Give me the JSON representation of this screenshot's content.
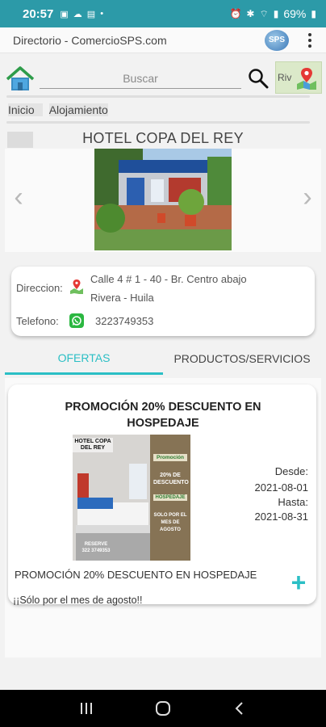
{
  "status_bar": {
    "time": "20:57",
    "battery": "69%"
  },
  "app_bar": {
    "title": "Directorio - ComercioSPS.com",
    "logo_text": "SPS"
  },
  "search": {
    "placeholder": "Buscar",
    "map_button_label": "Riv"
  },
  "breadcrumb": {
    "home": "Inicio",
    "category": "Alojamiento"
  },
  "business": {
    "name": "HOTEL COPA DEL REY",
    "address_label": "Direccion:",
    "address_line1": "Calle 4  # 1 - 40  - Br. Centro abajo",
    "address_line2": "Rivera - Huila",
    "phone_label": "Telefono:",
    "phone": "3223749353"
  },
  "tabs": [
    {
      "label": "OFERTAS",
      "active": true
    },
    {
      "label": "PRODUCTOS/SERVICIOS",
      "active": false
    }
  ],
  "offer": {
    "title": "PROMOCIÓN  20% DESCUENTO EN HOSPEDAJE",
    "from_label": "Desde:",
    "from_date": "2021-08-01",
    "to_label": "Hasta:",
    "to_date": "2021-08-31",
    "description": "PROMOCIÓN  20% DESCUENTO EN HOSPEDAJE",
    "note": "¡¡Sólo por el mes de agosto!!",
    "image": {
      "header": "HOTEL COPA DEL REY",
      "promo_label": "Promoción",
      "discount": "20% DE DESCUENTO",
      "service": "HOSPEDAJE",
      "validity": "SOLO POR EL MES DE AGOSTO",
      "reserve_label": "RESERVE",
      "reserve_phone": "322 3749353"
    }
  },
  "colors": {
    "status_bar": "#2c9aa8",
    "accent": "#2bbfc5",
    "whatsapp": "#2bb741"
  }
}
